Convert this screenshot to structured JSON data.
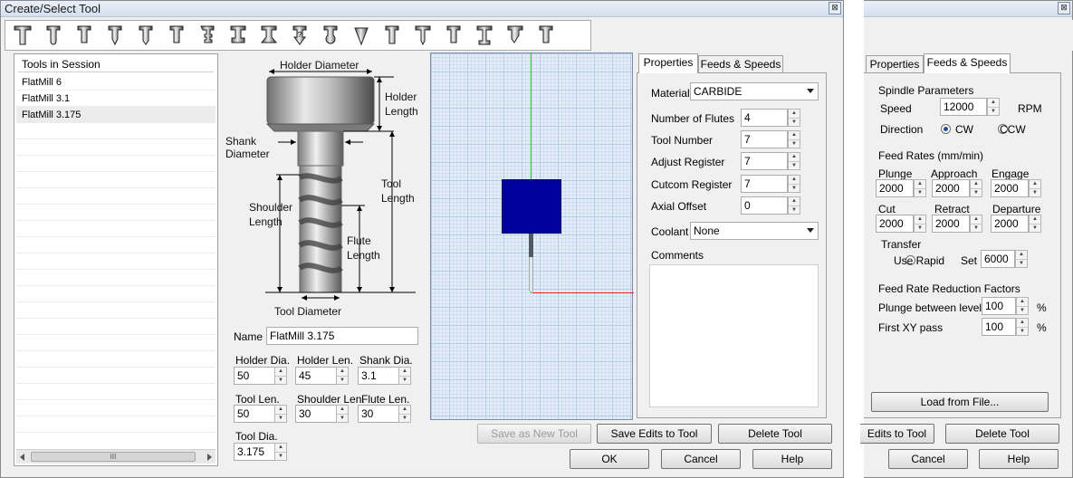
{
  "main_window": {
    "title": "Create/Select Tool",
    "close_glyph": "⊠"
  },
  "toolbar": {
    "icons": [
      "flat-mill-tool-icon",
      "ball-mill-tool-icon",
      "bull-mill-tool-icon",
      "chamfer-mill-tool-icon",
      "drill-tool-icon",
      "tap-tool-icon",
      "thread-mill-tool-icon",
      "slot-mill-tool-icon",
      "dovetail-mill-tool-icon",
      "center-drill-tool-icon",
      "lollipop-tool-icon",
      "engraving-tool-icon",
      "boring-bar-tool-icon",
      "tapered-mill-tool-icon",
      "reamer-tool-icon",
      "counterbore-tool-icon",
      "countersink-tool-icon",
      "form-tool-icon"
    ]
  },
  "tools_list": {
    "header": "Tools in Session",
    "items": [
      "FlatMill 6",
      "FlatMill 3.1",
      "FlatMill 3.175"
    ],
    "selected_index": 2,
    "scroll_grip": "III"
  },
  "diagram": {
    "holder_diameter": "Holder Diameter",
    "holder_length": "Holder Length",
    "shank_diameter": "Shank Diameter",
    "tool_length": "Tool Length",
    "shoulder_length": "Shoulder Length",
    "flute_length": "Flute Length",
    "tool_diameter": "Tool Diameter"
  },
  "params": {
    "name_label": "Name",
    "name_value": "FlatMill 3.175",
    "holder_dia_label": "Holder Dia.",
    "holder_dia_value": "50",
    "holder_len_label": "Holder Len.",
    "holder_len_value": "45",
    "shank_dia_label": "Shank Dia.",
    "shank_dia_value": "3.1",
    "tool_len_label": "Tool Len.",
    "tool_len_value": "50",
    "shoulder_len_label": "Shoulder Len.",
    "shoulder_len_value": "30",
    "flute_len_label": "Flute Len.",
    "flute_len_value": "30",
    "tool_dia_label": "Tool Dia.",
    "tool_dia_value": "3.175"
  },
  "tabs": {
    "properties": "Properties",
    "feeds_speeds": "Feeds & Speeds"
  },
  "properties": {
    "material_label": "Material",
    "material_value": "CARBIDE",
    "flutes_label": "Number of Flutes",
    "flutes_value": "4",
    "tool_number_label": "Tool Number",
    "tool_number_value": "7",
    "adjust_register_label": "Adjust Register",
    "adjust_register_value": "7",
    "cutcom_register_label": "Cutcom Register",
    "cutcom_register_value": "7",
    "axial_offset_label": "Axial Offset",
    "axial_offset_value": "0",
    "coolant_label": "Coolant",
    "coolant_value": "None",
    "comments_label": "Comments"
  },
  "buttons": {
    "save_as_new": "Save as New Tool",
    "save_edits": "Save Edits to Tool",
    "delete": "Delete Tool",
    "ok": "OK",
    "cancel": "Cancel",
    "help": "Help"
  },
  "second_window": {
    "close_glyph": "⊠",
    "spindle_title": "Spindle Parameters",
    "speed_label": "Speed",
    "speed_value": "12000",
    "rpm": "RPM",
    "direction_label": "Direction",
    "cw": "CW",
    "ccw": "CCW",
    "feed_rates_title": "Feed Rates (mm/min)",
    "plunge_label": "Plunge",
    "plunge_value": "2000",
    "approach_label": "Approach",
    "approach_value": "2000",
    "engage_label": "Engage",
    "engage_value": "2000",
    "cut_label": "Cut",
    "cut_value": "2000",
    "retract_label": "Retract",
    "retract_value": "2000",
    "departure_label": "Departure",
    "departure_value": "2000",
    "transfer_label": "Transfer",
    "use_rapid": "Use Rapid",
    "set": "Set",
    "set_value": "6000",
    "reduction_title": "Feed Rate Reduction Factors",
    "plunge_between_label": "Plunge between levels",
    "plunge_between_value": "100",
    "first_xy_label": "First XY pass",
    "first_xy_value": "100",
    "percent": "%",
    "load_button": "Load from File...",
    "save_edits_partial": "Edits to Tool",
    "delete": "Delete Tool",
    "cancel": "Cancel",
    "help": "Help"
  },
  "colors": {
    "holder_block": "#00009c",
    "axis_green": "#18c818",
    "axis_red": "#e02020"
  }
}
